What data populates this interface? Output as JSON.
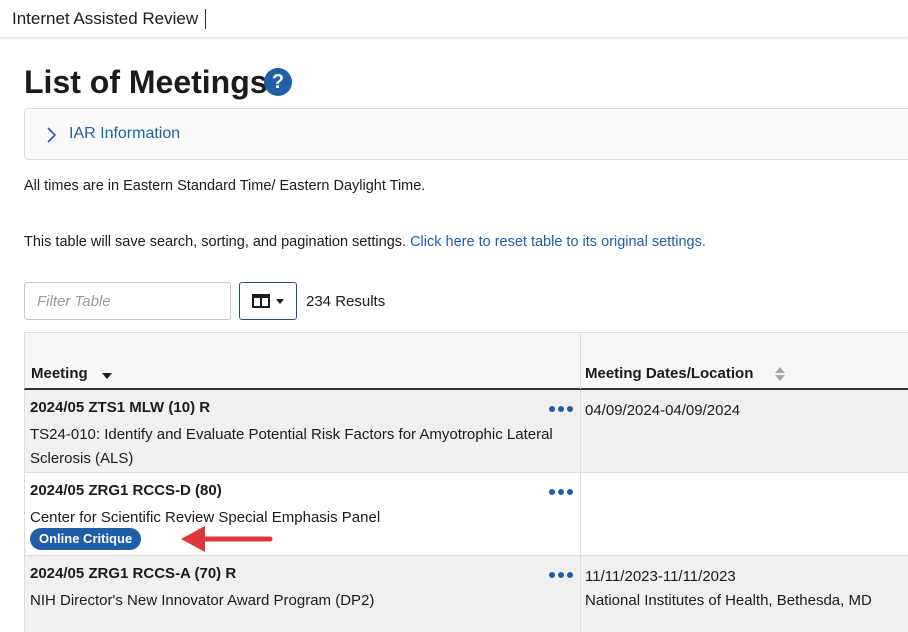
{
  "app": {
    "title": "Internet Assisted Review"
  },
  "page": {
    "title": "List of Meetings"
  },
  "accordion": {
    "label": "IAR Information"
  },
  "info": {
    "timezone_note": "All times are in Eastern Standard Time/ Eastern Daylight Time.",
    "save_note": "This table will save search, sorting, and pagination settings.",
    "reset_link": "Click here to reset table to its original settings."
  },
  "toolbar": {
    "filter_placeholder": "Filter Table",
    "results": "234 Results"
  },
  "table": {
    "columns": [
      "Meeting",
      "Meeting Dates/Location"
    ],
    "rows": [
      {
        "code": "2024/05 ZTS1 MLW (10) R",
        "description": "TS24-010: Identify and Evaluate Potential Risk Factors for Amyotrophic Lateral Sclerosis (ALS)",
        "dates": "04/09/2024-04/09/2024",
        "location": ""
      },
      {
        "code": "2024/05 ZRG1 RCCS-D (80)",
        "description": "Center for Scientific Review Special Emphasis Panel",
        "badge": "Online Critique",
        "dates": "",
        "location": ""
      },
      {
        "code": "2024/05 ZRG1 RCCS-A (70) R",
        "description": "NIH Director's New Innovator Award Program (DP2)",
        "dates": "11/11/2023-11/11/2023",
        "location": "National Institutes of Health, Bethesda, MD"
      }
    ]
  },
  "colors": {
    "link": "#1f5ea8",
    "badge": "#1f5ea8",
    "arrow": "#e0353a"
  }
}
